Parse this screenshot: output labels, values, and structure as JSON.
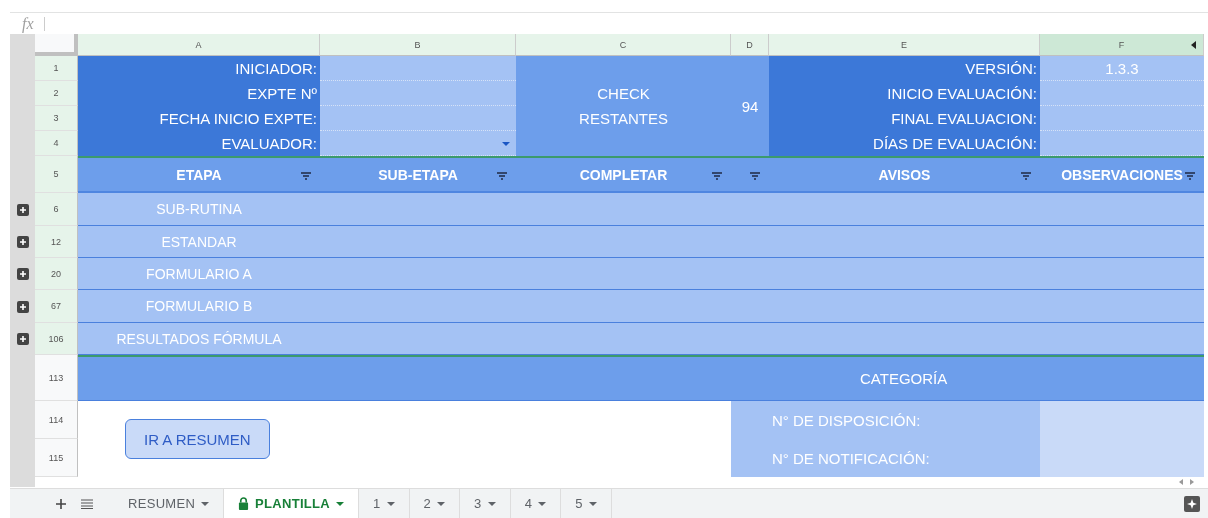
{
  "formula_bar": {
    "label": "fx"
  },
  "columns": [
    {
      "label": "A",
      "selected": false
    },
    {
      "label": "B",
      "selected": false
    },
    {
      "label": "C",
      "selected": false
    },
    {
      "label": "D",
      "selected": false
    },
    {
      "label": "E",
      "selected": false
    },
    {
      "label": "F",
      "selected": true
    }
  ],
  "info_rows": [
    {
      "row": "1",
      "selected": true,
      "left_label": "INICIADOR:",
      "right_label": "VERSIÓN:",
      "right_value": "1.3.3"
    },
    {
      "row": "2",
      "selected": true,
      "left_label": "EXPTE Nº",
      "right_label": "INICIO EVALUACIÓN:"
    },
    {
      "row": "3",
      "selected": true,
      "left_label": "FECHA INICIO EXPTE:",
      "right_label": "FINAL EVALUACION:"
    },
    {
      "row": "4",
      "selected": true,
      "left_label": "EVALUADOR:",
      "right_label": "DÍAS DE EVALUACIÓN:",
      "dropdown": true
    }
  ],
  "check": {
    "lines": [
      "CHECK",
      "RESTANTES"
    ],
    "count": "94"
  },
  "header_row": {
    "row": "5",
    "selected": true,
    "cells": [
      {
        "label": "ETAPA",
        "filter": true
      },
      {
        "label": "SUB-ETAPA",
        "filter": true
      },
      {
        "label": "COMPLETAR",
        "filter": true
      },
      {
        "filter": true
      },
      {
        "label": "AVISOS",
        "filter": true
      },
      {
        "label": "OBSERVACIONES",
        "filter": true
      }
    ]
  },
  "groups": [
    {
      "row": "6",
      "selected": true,
      "label": "SUB-RUTINA"
    },
    {
      "row": "12",
      "selected": true,
      "label": "ESTANDAR"
    },
    {
      "row": "20",
      "selected": true,
      "label": "FORMULARIO A"
    },
    {
      "row": "67",
      "selected": true,
      "label": "FORMULARIO B"
    },
    {
      "row": "106",
      "selected": true,
      "label": "RESULTADOS FÓRMULA"
    }
  ],
  "category_row": {
    "row": "113",
    "selected": false,
    "label": "CATEGORÍA"
  },
  "footer_rows": [
    {
      "row": "114",
      "selected": false,
      "label": "N° DE DISPOSICIÓN:"
    },
    {
      "row": "115",
      "selected": false,
      "label": "N° DE NOTIFICACIÓN:"
    }
  ],
  "button": {
    "label": "IR A RESUMEN"
  },
  "sheet_tabs": [
    {
      "label": "RESUMEN",
      "selected": false,
      "locked": false
    },
    {
      "label": "PLANTILLA",
      "selected": true,
      "locked": true
    },
    {
      "label": "1",
      "selected": false,
      "locked": false
    },
    {
      "label": "2",
      "selected": false,
      "locked": false
    },
    {
      "label": "3",
      "selected": false,
      "locked": false
    },
    {
      "label": "4",
      "selected": false,
      "locked": false
    },
    {
      "label": "5",
      "selected": false,
      "locked": false
    }
  ]
}
